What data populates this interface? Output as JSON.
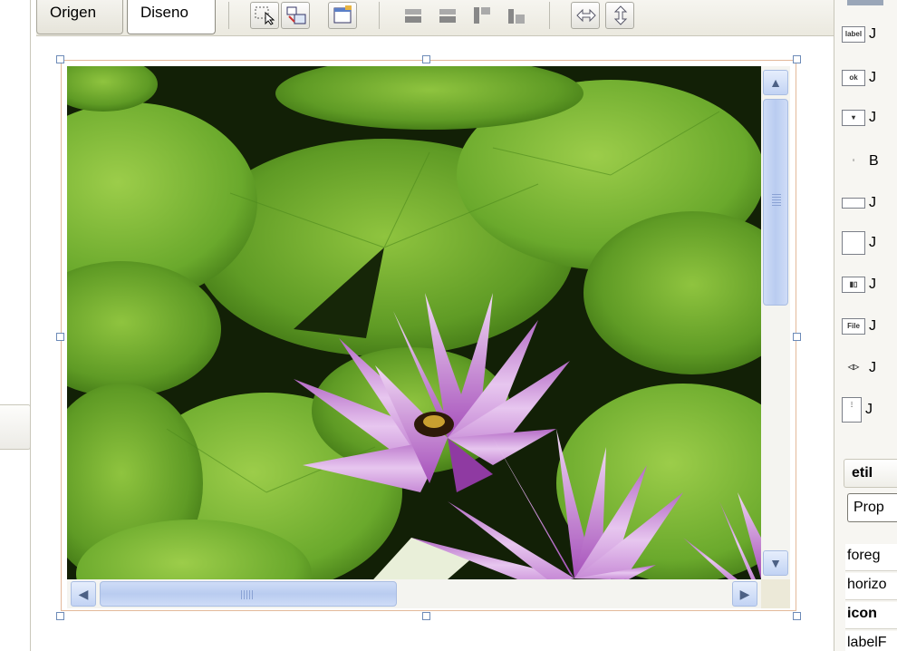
{
  "editor_tabs": {
    "source_label": "Origen",
    "design_label": "Diseno"
  },
  "palette": {
    "items": [
      {
        "icon_text": "label",
        "text": "J"
      },
      {
        "icon_text": "ok",
        "text": "J"
      },
      {
        "icon_text": "▾",
        "text": "J"
      },
      {
        "icon_text": "◦",
        "text": "B"
      },
      {
        "icon_text": "",
        "text": "J"
      },
      {
        "icon_text": "",
        "text": "J"
      },
      {
        "icon_text": "▮▯",
        "text": "J"
      },
      {
        "icon_text": "File",
        "text": "J"
      },
      {
        "icon_text": "◁▷",
        "text": "J"
      },
      {
        "icon_text": "⫶",
        "text": "J"
      }
    ]
  },
  "properties": {
    "component_name": "etiI",
    "tab_label": "Prop",
    "rows": [
      {
        "label": "foreg",
        "bold": false
      },
      {
        "label": "horizo",
        "bold": false
      },
      {
        "label": "icon",
        "bold": true
      },
      {
        "label": "labelF",
        "bold": false
      }
    ]
  },
  "colors": {
    "scroll_accent": "#c2d3f4",
    "selection_border": "#e3b99a"
  }
}
